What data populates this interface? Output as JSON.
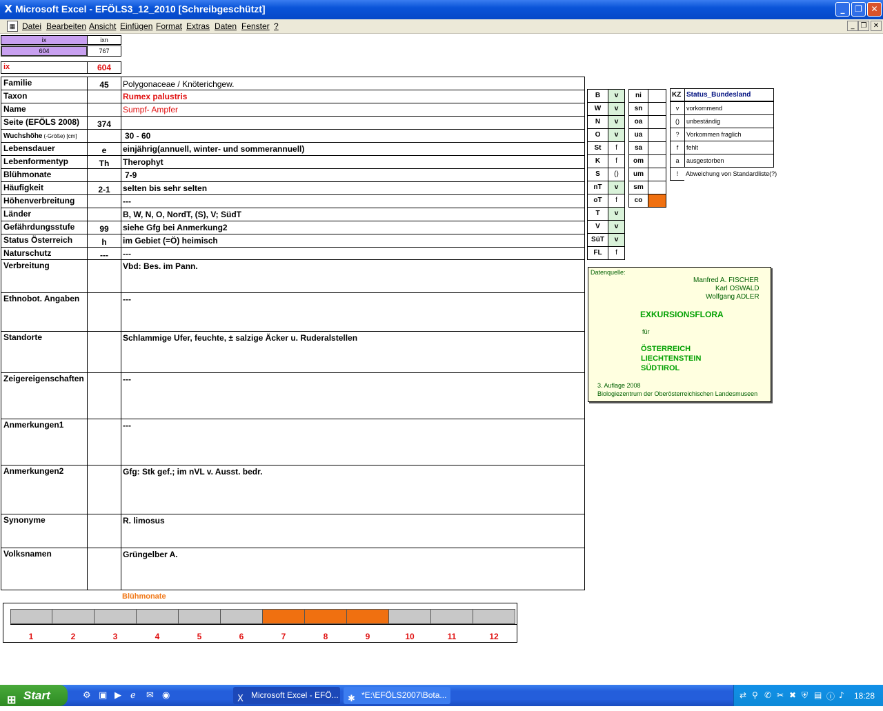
{
  "window": {
    "title": "Microsoft Excel - EFÖLS3_12_2010  [Schreibgeschützt]"
  },
  "menu": [
    "Datei",
    "Bearbeiten",
    "Ansicht",
    "Einfügen",
    "Format",
    "Extras",
    "Daten",
    "Fenster",
    "?"
  ],
  "top": {
    "ix_label": "ix",
    "ixn_label": "ixn",
    "ix_val": "604",
    "ixn_val": "767",
    "ix_big_label": "ix",
    "ix_big_val": "604"
  },
  "rows": [
    {
      "label": "Familie",
      "code": "45",
      "value": "Polygonaceae  /  Knöterichgew."
    },
    {
      "label": "Taxon",
      "code": "",
      "value": "Rumex palustris"
    },
    {
      "label": "Name",
      "code": "",
      "value": "Sumpf- Ampfer"
    },
    {
      "label": "Seite (EFÖLS 2008)",
      "code": "374",
      "value": ""
    },
    {
      "label": "Wuchshöhe",
      "label_small": "(-Größe) [cm]",
      "code": "",
      "value": "30 - 60"
    },
    {
      "label": "Lebensdauer",
      "code": "e",
      "value": "einjährig(annuell, winter- und sommerannuell)"
    },
    {
      "label": "Lebenformentyp",
      "code": "Th",
      "value": "Therophyt"
    },
    {
      "label": "Blühmonate",
      "code": "",
      "value": "7-9"
    },
    {
      "label": "Häufigkeit",
      "code": "2-1",
      "value": "selten bis sehr selten"
    },
    {
      "label": "Höhenverbreitung",
      "code": "",
      "value": "---"
    },
    {
      "label": "Länder",
      "code": "",
      "value": "B, W, N, O, NordT, (S), V; SüdT"
    },
    {
      "label": "Gefährdungsstufe",
      "code": "99",
      "value": "siehe Gfg bei Anmerkung2"
    },
    {
      "label": "Status Österreich",
      "code": "h",
      "value": "im Gebiet (=Ö) heimisch"
    },
    {
      "label": "Naturschutz",
      "code": "---",
      "value": "---"
    },
    {
      "label": "Verbreitung",
      "code": "",
      "value": "Vbd: Bes. im Pann."
    },
    {
      "label": "Ethnobot. Angaben",
      "code": "",
      "value": "---"
    },
    {
      "label": "Standorte",
      "code": "",
      "value": "Schlammige Ufer, feuchte, ± salzige Äcker u. Ruderalstellen"
    },
    {
      "label": "Zeigereigenschaften",
      "code": "",
      "value": "---"
    },
    {
      "label": "Anmerkungen1",
      "code": "",
      "value": "---"
    },
    {
      "label": "Anmerkungen2",
      "code": "",
      "value": "Gfg: Stk gef.; im nVL v. Ausst. bedr."
    },
    {
      "label": "Synonyme",
      "code": "",
      "value": "R. limosus"
    },
    {
      "label": "Volksnamen",
      "code": "",
      "value": "Grüngelber A."
    }
  ],
  "states": [
    {
      "k": "B",
      "v": "v"
    },
    {
      "k": "W",
      "v": "v"
    },
    {
      "k": "N",
      "v": "v"
    },
    {
      "k": "O",
      "v": "v"
    },
    {
      "k": "St",
      "v": "f"
    },
    {
      "k": "K",
      "v": "f"
    },
    {
      "k": "S",
      "v": "()"
    },
    {
      "k": "nT",
      "v": "v"
    },
    {
      "k": "oT",
      "v": "f"
    },
    {
      "k": "T",
      "v": "v"
    },
    {
      "k": "V",
      "v": "v"
    },
    {
      "k": "SüT",
      "v": "v"
    },
    {
      "k": "FL",
      "v": "f"
    }
  ],
  "zones": [
    "ni",
    "sn",
    "oa",
    "ua",
    "sa",
    "om",
    "um",
    "sm",
    "co"
  ],
  "legend": {
    "kz_header": "KZ",
    "status_header": "Status_Bundesland",
    "items": [
      {
        "kz": "v",
        "text": "vorkommend"
      },
      {
        "kz": "()",
        "text": "unbeständig"
      },
      {
        "kz": "?",
        "text": "Vorkommen fraglich"
      },
      {
        "kz": "f",
        "text": "fehlt"
      },
      {
        "kz": "a",
        "text": "ausgestorben"
      },
      {
        "kz": "!",
        "text": "Abweichung von Standardliste(?)"
      }
    ]
  },
  "source": {
    "label": "Datenquelle:",
    "author1": "Manfred A. FISCHER",
    "author2": "Karl OSWALD",
    "author3": "Wolfgang ADLER",
    "title": "EXKURSIONSFLORA",
    "fuer": "für",
    "country1": "ÖSTERREICH",
    "country2": "LIECHTENSTEIN",
    "country3": "SÜDTIROL",
    "edition": "3. Auflage 2008",
    "publisher": "Biologiezentrum der Oberösterreichischen Landesmuseen"
  },
  "bloom": {
    "title": "Blühmonate",
    "months": [
      "1",
      "2",
      "3",
      "4",
      "5",
      "6",
      "7",
      "8",
      "9",
      "10",
      "11",
      "12"
    ],
    "active": [
      false,
      false,
      false,
      false,
      false,
      false,
      true,
      true,
      true,
      false,
      false,
      false
    ],
    "color_active": "#f07010",
    "color_inactive": "#c8c8c8"
  },
  "taskbar": {
    "start": "Start",
    "tasks": [
      "Microsoft Excel - EFÖ...",
      "*E:\\EFÖLS2007\\Bota..."
    ],
    "clock": "18:28"
  }
}
